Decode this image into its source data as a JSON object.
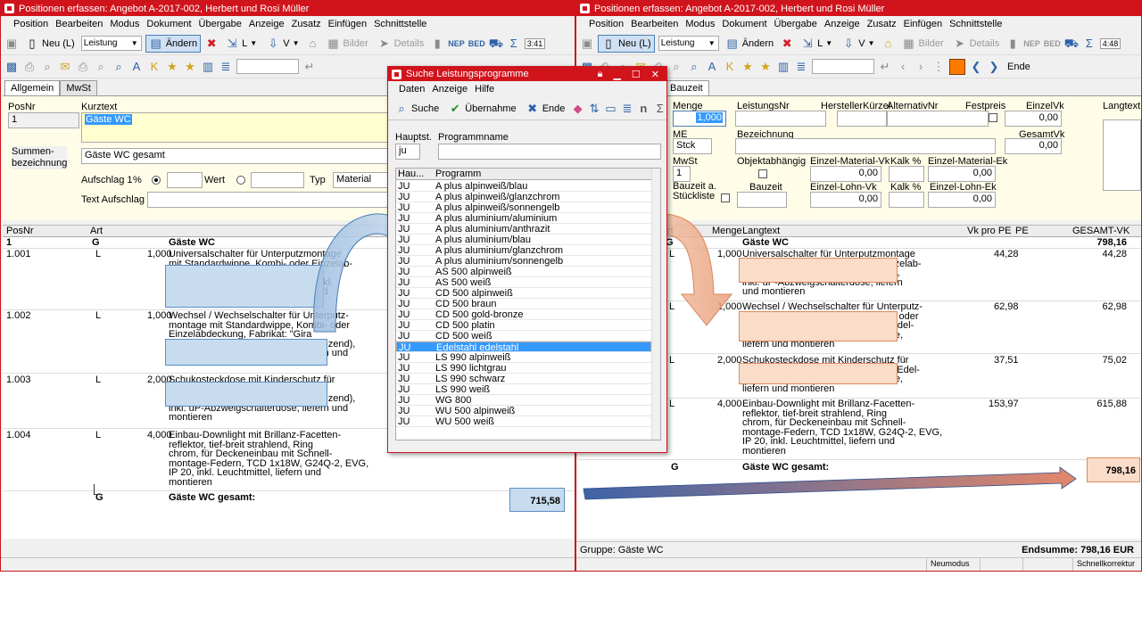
{
  "left": {
    "title": "Positionen erfassen: Angebot A-2017-002, Herbert und Rosi Müller",
    "menu": [
      "Position",
      "Bearbeiten",
      "Modus",
      "Dokument",
      "Übergabe",
      "Anzeige",
      "Zusatz",
      "Einfügen",
      "Schnittstelle"
    ],
    "toolbar1": {
      "neu": "Neu (L)",
      "leistung": "Leistung",
      "andern": "Ändern",
      "l": "L",
      "v": "V",
      "bilder": "Bilder",
      "details": "Details",
      "nep": "NEP",
      "bed": "BED",
      "time": "3:41"
    },
    "toolbar2": {
      "ende": "Ende"
    },
    "tabs": [
      "Allgemein",
      "MwSt"
    ],
    "form": {
      "posnr_label": "PosNr",
      "posnr": "1",
      "kurztext_label": "Kurztext",
      "kurztext": "Gäste WC",
      "summen_label": "Summen-\nbezeichnung",
      "summen": "Gäste WC gesamt",
      "aufschlag_label": "Aufschlag 1",
      "percent": "%",
      "wert": "Wert",
      "typ": "Typ",
      "typ_value": "Material",
      "text_aufschlag": "Text Aufschlag"
    },
    "grid": {
      "headers": {
        "posnr": "PosNr",
        "art": "Art"
      },
      "rows": [
        {
          "posnr": "1",
          "art": "G",
          "menge": "",
          "text": "Gäste WC",
          "bold": true
        },
        {
          "posnr": "1.001",
          "art": "L",
          "menge": "1,000",
          "text": "Universalschalter für Unterputzmontage\nmit Standardwippe, Kombi- oder Einzelab-\ndeckung, Fabrikat \"Gira Standard\nSystem 55\" (reinweiß, glänzend), inkl.\nuP-Abzweigschalterdose, liefern und\nmontieren"
        },
        {
          "posnr": "1.002",
          "art": "L",
          "menge": "1,000",
          "text": "Wechsel / Wechselschalter für Unterputz-\nmontage mit Standardwippe, Kombi- oder\nEinzelabdeckung, Fabrikat: \"Gira\nStandard System 55\" (reinweiß, glänzend),\ninkl. uP-Abzweigschalterdose, liefern und\nmontieren"
        },
        {
          "posnr": "1.003",
          "art": "L",
          "menge": "2,000",
          "text": "Schukosteckdose mit Kinderschutz für\nUnterputzmontage, Fabrikat: \"Gira\nStandard System 55\" (reinweiß, glänzend),\ninkl. uP-Abzweigschalterdose, liefern und\nmontieren"
        },
        {
          "posnr": "1.004",
          "art": "L",
          "menge": "4,000",
          "text": "Einbau-Downlight mit Brillanz-Facetten-\nreflektor, tief-breit strahlend, Ring\nchrom, für Deckeneinbau mit Schnell-\nmontage-Federn, TCD 1x18W, G24Q-2, EVG,\nIP 20, inkl. Leuchtmittel, liefern und\nmontieren"
        },
        {
          "posnr": "",
          "art": "G",
          "menge": "",
          "text": "Gäste WC gesamt:",
          "bold": true
        }
      ],
      "total": "715,58"
    }
  },
  "right": {
    "title": "Positionen erfassen: Angebot A-2017-002, Herbert und Rosi Müller",
    "menu": [
      "Position",
      "Bearbeiten",
      "Modus",
      "Dokument",
      "Übergabe",
      "Anzeige",
      "Zusatz",
      "Einfügen",
      "Schnittstelle"
    ],
    "toolbar1": {
      "neu": "Neu (L)",
      "leistung": "Leistung",
      "andern": "Ändern",
      "l": "L",
      "v": "V",
      "bilder": "Bilder",
      "details": "Details",
      "nep": "NEP",
      "bed": "BED",
      "time": "4:48"
    },
    "toolbar2": {
      "ende": "Ende"
    },
    "tab": "Bauzeit",
    "form": {
      "menge_label": "Menge",
      "menge": "1,000",
      "leistungsnr_label": "LeistungsNr",
      "hersteller_label": "HerstellerKürzel",
      "alternativ_label": "AlternativNr",
      "festpreis_label": "Festpreis",
      "einzelvk_label": "EinzelVk",
      "einzelvk": "0,00",
      "langtext_label": "Langtext",
      "me_label": "ME",
      "me": "Stck",
      "bezeichnung_label": "Bezeichnung",
      "gesamtvk_label": "GesamtVk",
      "gesamtvk": "0,00",
      "mwst_label": "MwSt",
      "mwst": "1",
      "objekt_label": "Objektabhängig",
      "ezmat_vk_label": "Einzel-Material-Vk",
      "ezmat_vk": "0,00",
      "kalk_label": "Kalk %",
      "ezmat_ek_label": "Einzel-Material-Ek",
      "ezmat_ek": "0,00",
      "bauzeit_stueck_label": "Bauzeit a.\nStückliste",
      "bauzeit_label": "Bauzeit",
      "ezlohn_vk_label": "Einzel-Lohn-Vk",
      "ezlohn_vk": "0,00",
      "kalk2_label": "Kalk %",
      "ezlohn_ek_label": "Einzel-Lohn-Ek",
      "ezlohn_ek": "0,00"
    },
    "grid": {
      "headers": {
        "art": "rt",
        "menge": "Menge",
        "langtext": "Langtext",
        "vkpro": "Vk pro PE",
        "pe": "PE",
        "gesamt": "GESAMT-VK"
      },
      "rows": [
        {
          "art": "G",
          "menge": "",
          "text": "Gäste WC",
          "vk": "",
          "gesamt": "798,16",
          "bold": true
        },
        {
          "art": "L",
          "menge": "1,000",
          "text": "Universalschalter für Unterputzmontage\nmit Flächenwippe, Kombi- oder Einzelab-\ndeckung, Fabrikat: \"Jung Edelstahl\",\ninkl. uP-Abzweigschalterdose, liefern\nund montieren",
          "vk": "44,28",
          "gesamt": "44,28"
        },
        {
          "art": "L",
          "menge": "1,000",
          "text": "Wechsel / Wechselschalter für Unterputz-\nmontage mit Flächenwippe, Kombi- oder\nEinzelabdeckung, Fabrikat: \"Jung Edel-\nstahl\", inkl. uP-Abzweigschalterdose,\nliefern und montieren",
          "vk": "62,98",
          "gesamt": "62,98"
        },
        {
          "art": "L",
          "menge": "2,000",
          "text": "Schukosteckdose mit Kinderschutz für\nUnterputzmontage, Fabrikat: \"Jung Edel-\nstahl\", inkl. uP-Abzweigschalterdose,\nliefern und montieren",
          "vk": "37,51",
          "gesamt": "75,02"
        },
        {
          "art": "L",
          "menge": "4,000",
          "text": "Einbau-Downlight mit Brillanz-Facetten-\nreflektor, tief-breit strahlend, Ring\nchrom, für Deckeneinbau mit Schnell-\nmontage-Federn, TCD 1x18W, G24Q-2, EVG,\nIP 20, inkl. Leuchtmittel, liefern und\nmontieren",
          "vk": "153,97",
          "gesamt": "615,88"
        },
        {
          "art": "G",
          "menge": "",
          "text": "Gäste WC gesamt:",
          "vk": "",
          "gesamt": "",
          "bold": true
        }
      ],
      "total": "798,16"
    },
    "gruppe": "Gruppe: Gäste WC",
    "endsumme": "Endsumme: 798,16 EUR",
    "status": {
      "neumodus": "Neumodus",
      "schnell": "Schnellkorrektur"
    }
  },
  "dialog": {
    "title": "Suche Leistungsprogramme",
    "menu": [
      "Daten",
      "Anzeige",
      "Hilfe"
    ],
    "toolbar": {
      "suche": "Suche",
      "uebernahme": "Übernahme",
      "ende": "Ende"
    },
    "hauptst_label": "Hauptst.",
    "hauptst": "ju",
    "programm_label": "Programmname",
    "list_headers": [
      "Hau...",
      "Programm"
    ],
    "items": [
      [
        "JU",
        "A plus alpinweiß/blau"
      ],
      [
        "JU",
        "A plus alpinweiß/glanzchrom"
      ],
      [
        "JU",
        "A plus alpinweiß/sonnengelb"
      ],
      [
        "JU",
        "A plus aluminium/aluminium"
      ],
      [
        "JU",
        "A plus aluminium/anthrazit"
      ],
      [
        "JU",
        "A plus aluminium/blau"
      ],
      [
        "JU",
        "A plus aluminium/glanzchrom"
      ],
      [
        "JU",
        "A plus aluminium/sonnengelb"
      ],
      [
        "JU",
        "AS 500 alpinweiß"
      ],
      [
        "JU",
        "AS 500 weiß"
      ],
      [
        "JU",
        "CD 500 alpinweiß"
      ],
      [
        "JU",
        "CD 500 braun"
      ],
      [
        "JU",
        "CD 500 gold-bronze"
      ],
      [
        "JU",
        "CD 500 platin"
      ],
      [
        "JU",
        "CD 500 weiß"
      ],
      [
        "JU",
        "Edelstahl edelstahl"
      ],
      [
        "JU",
        "LS 990 alpinweiß"
      ],
      [
        "JU",
        "LS 990 lichtgrau"
      ],
      [
        "JU",
        "LS 990 schwarz"
      ],
      [
        "JU",
        "LS 990 weiß"
      ],
      [
        "JU",
        "WG 800"
      ],
      [
        "JU",
        "WU 500 alpinweiß"
      ],
      [
        "JU",
        "WU 500 weiß"
      ]
    ],
    "selected_index": 15
  },
  "colors": {
    "title_red": "#d1141c",
    "highlight_blue": "#c8dcf0",
    "highlight_orange": "#fbdcc8",
    "selection": "#3399ff"
  }
}
